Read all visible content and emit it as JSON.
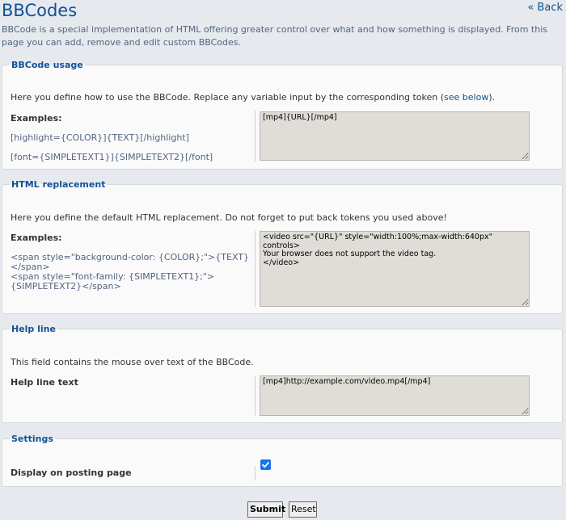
{
  "header": {
    "title": "BBCodes",
    "back_label": "« Back",
    "intro": "BBCode is a special implementation of HTML offering greater control over what and how something is displayed. From this page you can add, remove and edit custom BBCodes."
  },
  "usage": {
    "legend": "BBCode usage",
    "intro_prefix": "Here you define how to use the BBCode. Replace any variable input by the corresponding token (",
    "intro_link": "see below",
    "intro_suffix": ").",
    "examples_label": "Examples:",
    "example_1": "[highlight={COLOR}]{TEXT}[/highlight]",
    "example_2": "[font={SIMPLETEXT1}]{SIMPLETEXT2}[/font]",
    "value": "[mp4]{URL}[/mp4]"
  },
  "html": {
    "legend": "HTML replacement",
    "intro": "Here you define the default HTML replacement. Do not forget to put back tokens you used above!",
    "examples_label": "Examples:",
    "example_1": "<span style=\"background-color: {COLOR};\">{TEXT}</span>",
    "example_2": "<span style=\"font-family: {SIMPLETEXT1};\">{SIMPLETEXT2}</span>",
    "value": "<video src=\"{URL}\" style=\"width:100%;max-width:640px\" controls>\nYour browser does not support the video tag.\n</video>"
  },
  "help": {
    "legend": "Help line",
    "intro": "This field contains the mouse over text of the BBCode.",
    "label": "Help line text",
    "value": "[mp4]http://example.com/video.mp4[/mp4]"
  },
  "settings": {
    "legend": "Settings",
    "display_label": "Display on posting page",
    "display_checked": true
  },
  "actions": {
    "submit_label": "Submit",
    "reset_label": "Reset"
  },
  "colors": {
    "title": "#115098",
    "link": "#105289",
    "background": "#e6e9ed",
    "panel": "#fafafa",
    "checkbox": "#1a73e8"
  }
}
